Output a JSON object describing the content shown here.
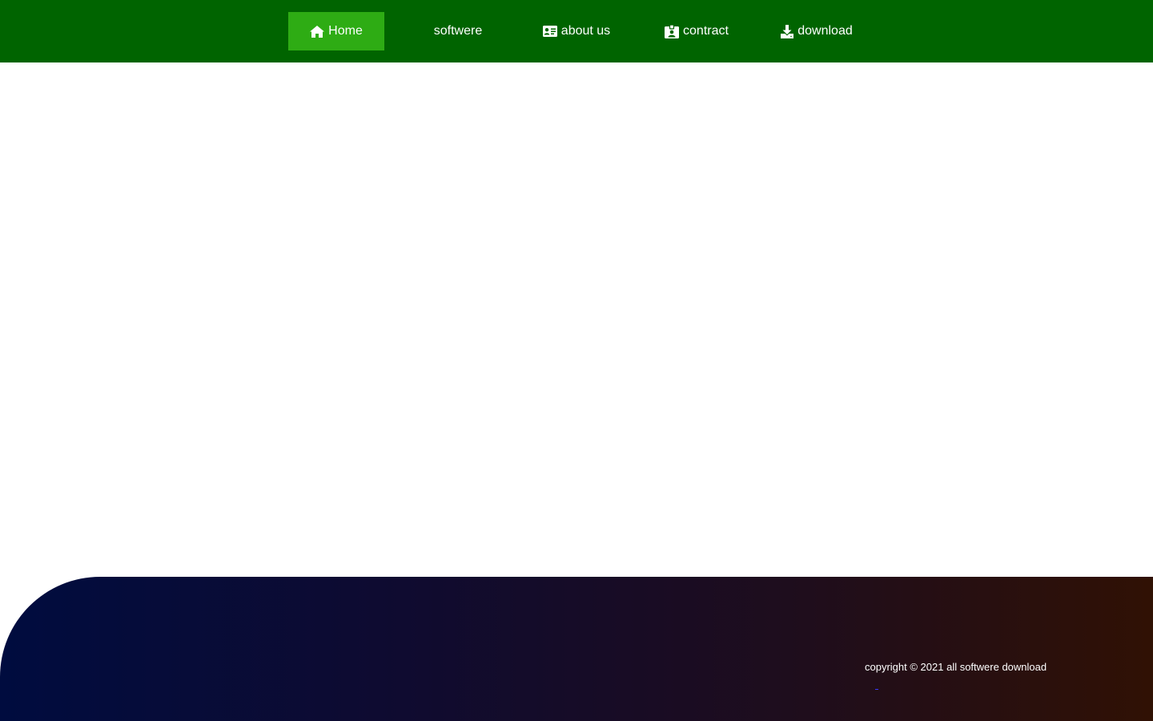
{
  "nav": {
    "items": [
      {
        "label": "Home",
        "icon": "home-icon",
        "active": true
      },
      {
        "label": "softwere",
        "icon": "",
        "active": false
      },
      {
        "label": "about us",
        "icon": "id-card-icon",
        "active": false
      },
      {
        "label": "contract",
        "icon": "id-badge-icon",
        "active": false
      },
      {
        "label": "download",
        "icon": "download-icon",
        "active": false
      }
    ]
  },
  "footer": {
    "copyright": "copyright © 2021 all softwere download"
  },
  "colors": {
    "navbar": "#006400",
    "active_nav": "#2eac14",
    "footer_gradient_start": "#000c3f",
    "footer_gradient_end": "#301104",
    "text": "#ffffff"
  }
}
